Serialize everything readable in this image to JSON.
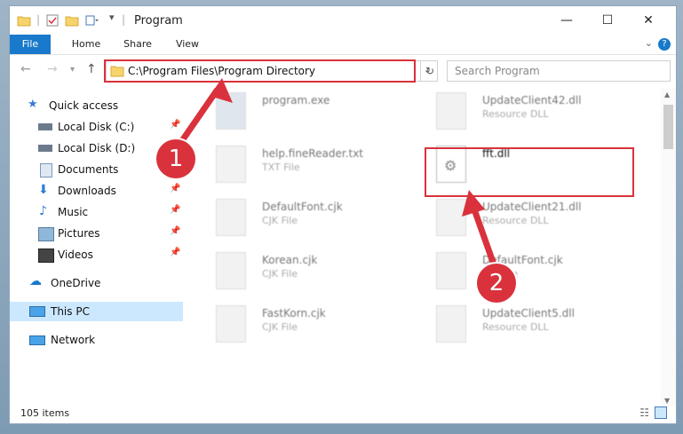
{
  "window": {
    "title": "Program",
    "controls": {
      "minimize": "—",
      "maximize": "☐",
      "close": "✕"
    }
  },
  "ribbon": {
    "tabs": [
      "File",
      "Home",
      "Share",
      "View"
    ],
    "help_icon": "?",
    "expand_icon": "⌄"
  },
  "address": {
    "path": "C:\\Program Files\\Program Directory",
    "search_placeholder": "Search Program"
  },
  "nav": {
    "items": [
      {
        "label": "Quick access",
        "icon": "star-icon"
      },
      {
        "label": "Local Disk (C:)",
        "icon": "drive-icon",
        "pinned": true
      },
      {
        "label": "Local Disk (D:)",
        "icon": "drive-icon"
      },
      {
        "label": "Documents",
        "icon": "documents-icon",
        "pinned": true
      },
      {
        "label": "Downloads",
        "icon": "download-icon",
        "pinned": true
      },
      {
        "label": "Music",
        "icon": "music-icon",
        "pinned": true
      },
      {
        "label": "Pictures",
        "icon": "pictures-icon",
        "pinned": true
      },
      {
        "label": "Videos",
        "icon": "videos-icon",
        "pinned": true
      },
      {
        "label": "OneDrive",
        "icon": "cloud-icon"
      },
      {
        "label": "This PC",
        "icon": "pc-icon",
        "selected": true
      },
      {
        "label": "Network",
        "icon": "network-icon"
      }
    ]
  },
  "files": [
    {
      "name": "program.exe",
      "type": ""
    },
    {
      "name": "UpdateClient42.dll",
      "type": "Resource DLL"
    },
    {
      "name": "help.fineReader.txt",
      "type": "TXT File"
    },
    {
      "name": "fft.dll",
      "type": ""
    },
    {
      "name": "DefaultFont.cjk",
      "type": "CJK File"
    },
    {
      "name": "UpdateClient21.dll",
      "type": "Resource DLL"
    },
    {
      "name": "Korean.cjk",
      "type": "CJK File"
    },
    {
      "name": "DefaultFont.cjk",
      "type": "CJK File"
    },
    {
      "name": "FastKorn.cjk",
      "type": "CJK File"
    },
    {
      "name": "UpdateClient5.dll",
      "type": "Resource DLL"
    }
  ],
  "status": {
    "items": "105 items"
  },
  "annotations": {
    "step1": "1",
    "step2": "2"
  },
  "colors": {
    "accent": "#1979ca",
    "annotation": "#d9323c",
    "selected": "#cce8ff"
  }
}
